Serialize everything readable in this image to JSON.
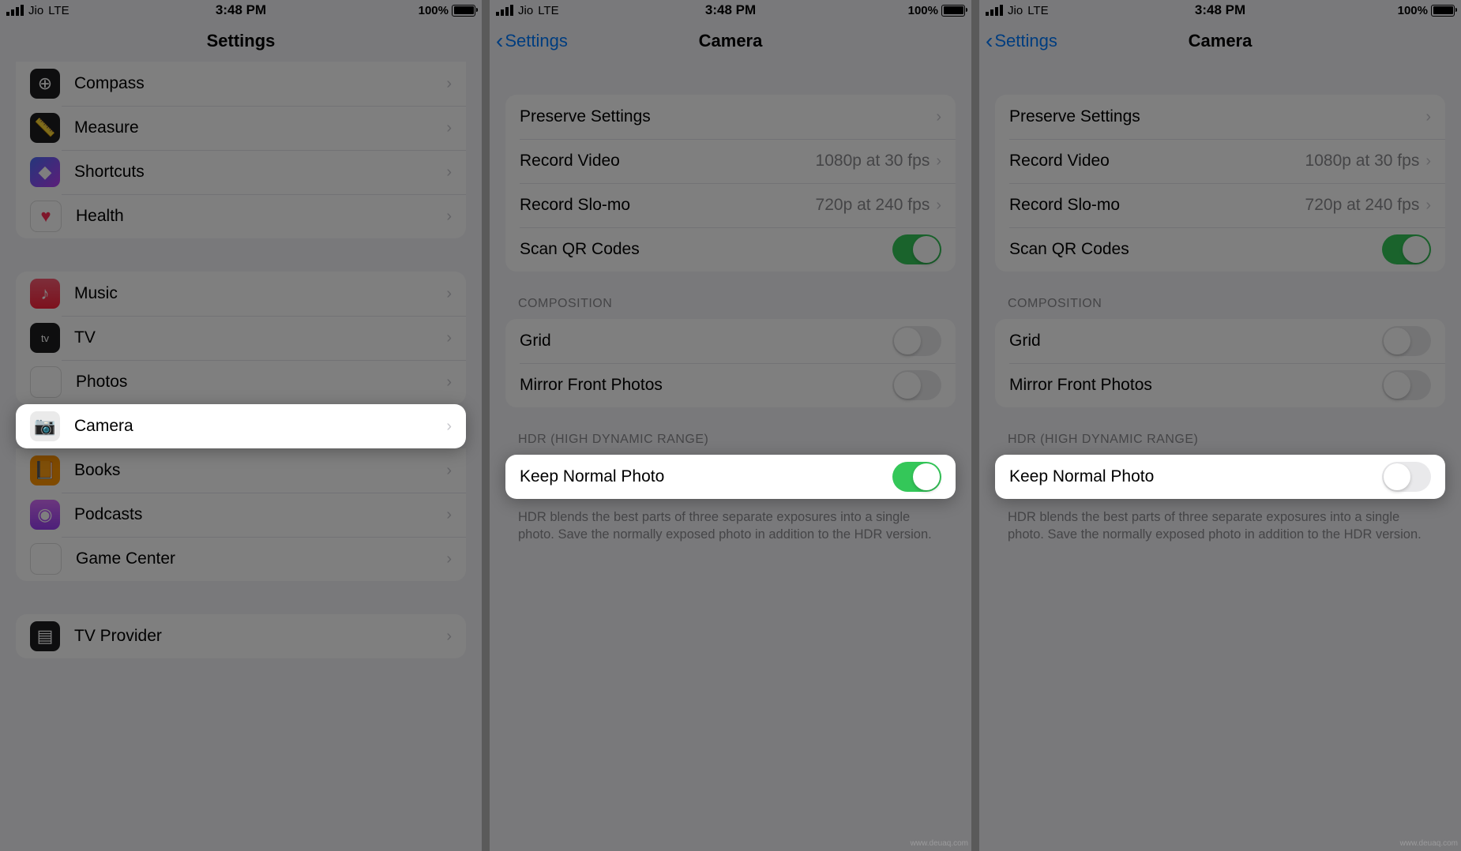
{
  "status": {
    "carrier": "Jio",
    "network": "LTE",
    "time": "3:48 PM",
    "battery_pct": "100%"
  },
  "screen1": {
    "title": "Settings",
    "items_top": [
      {
        "label": "Compass",
        "icon": "compass"
      },
      {
        "label": "Measure",
        "icon": "measure"
      },
      {
        "label": "Shortcuts",
        "icon": "shortcuts"
      },
      {
        "label": "Health",
        "icon": "health"
      }
    ],
    "items_mid": [
      {
        "label": "Music",
        "icon": "music"
      },
      {
        "label": "TV",
        "icon": "tv"
      },
      {
        "label": "Photos",
        "icon": "photos"
      },
      {
        "label": "Camera",
        "icon": "camera"
      },
      {
        "label": "Books",
        "icon": "books"
      },
      {
        "label": "Podcasts",
        "icon": "podcasts"
      },
      {
        "label": "Game Center",
        "icon": "gamecenter"
      }
    ],
    "items_bottom": [
      {
        "label": "TV Provider",
        "icon": "tvprovider"
      }
    ],
    "highlighted": "Camera"
  },
  "camera_screen": {
    "back_label": "Settings",
    "title": "Camera",
    "group1": [
      {
        "label": "Preserve Settings",
        "type": "disclosure"
      },
      {
        "label": "Record Video",
        "value": "1080p at 30 fps",
        "type": "disclosure"
      },
      {
        "label": "Record Slo-mo",
        "value": "720p at 240 fps",
        "type": "disclosure"
      },
      {
        "label": "Scan QR Codes",
        "type": "toggle",
        "on": true
      }
    ],
    "section_composition": "COMPOSITION",
    "group2": [
      {
        "label": "Grid",
        "type": "toggle",
        "on": false
      },
      {
        "label": "Mirror Front Photos",
        "type": "toggle",
        "on": false
      }
    ],
    "section_hdr": "HDR (HIGH DYNAMIC RANGE)",
    "hdr_row": {
      "label": "Keep Normal Photo"
    },
    "hdr_footer": "HDR blends the best parts of three separate exposures into a single photo. Save the normally exposed photo in addition to the HDR version."
  },
  "screen2_hdr_on": true,
  "screen3_hdr_on": false,
  "watermark": "www.deuaq.com"
}
